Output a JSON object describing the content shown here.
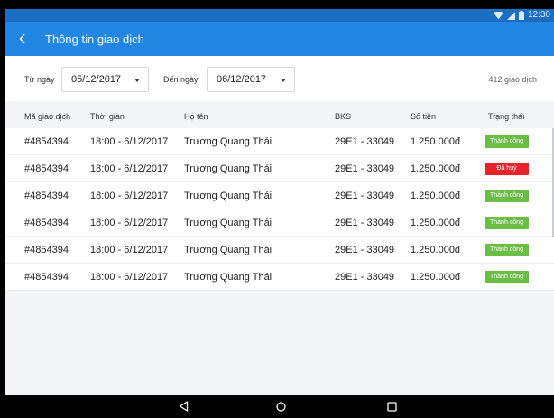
{
  "status_bar": {
    "time": "12:30",
    "icons": [
      "wifi-icon",
      "cell-signal-icon",
      "battery-icon"
    ]
  },
  "app_bar": {
    "back_icon": "chevron-left-icon",
    "title": "Thông tin giao dịch",
    "color": "#2286e4"
  },
  "filters": {
    "from_label": "Từ ngày",
    "from_value": "05/12/2017",
    "to_label": "Đến ngày",
    "to_value": "06/12/2017",
    "count_text": "412 giao dịch"
  },
  "table": {
    "headers": [
      "Mã giao dịch",
      "Thời gian",
      "Họ tên",
      "BKS",
      "Số tiền",
      "Trạng thái"
    ],
    "rows": [
      {
        "id": "#4854394",
        "time": "18:00 - 6/12/2017",
        "name": "Trương Quang Thái",
        "plate": "29E1 - 33049",
        "amount": "1.250.000đ",
        "status": "Thành công",
        "status_color": "#6cbd45"
      },
      {
        "id": "#4854394",
        "time": "18:00 - 6/12/2017",
        "name": "Trương Quang Thái",
        "plate": "29E1 - 33049",
        "amount": "1.250.000đ",
        "status": "Đã huỷ",
        "status_color": "#e8232a"
      },
      {
        "id": "#4854394",
        "time": "18:00 - 6/12/2017",
        "name": "Trương Quang Thái",
        "plate": "29E1 - 33049",
        "amount": "1.250.000đ",
        "status": "Thành công",
        "status_color": "#6cbd45"
      },
      {
        "id": "#4854394",
        "time": "18:00 - 6/12/2017",
        "name": "Trương Quang Thái",
        "plate": "29E1 - 33049",
        "amount": "1.250.000đ",
        "status": "Thành công",
        "status_color": "#6cbd45"
      },
      {
        "id": "#4854394",
        "time": "18:00 - 6/12/2017",
        "name": "Trương Quang Thái",
        "plate": "29E1 - 33049",
        "amount": "1.250.000đ",
        "status": "Thành công",
        "status_color": "#6cbd45"
      },
      {
        "id": "#4854394",
        "time": "18:00 - 6/12/2017",
        "name": "Trương Quang Thái",
        "plate": "29E1 - 33049",
        "amount": "1.250.000đ",
        "status": "Thành công",
        "status_color": "#6cbd45"
      }
    ]
  },
  "nav_bar": {
    "icons": [
      "back-triangle-icon",
      "home-circle-icon",
      "recents-square-icon"
    ]
  }
}
